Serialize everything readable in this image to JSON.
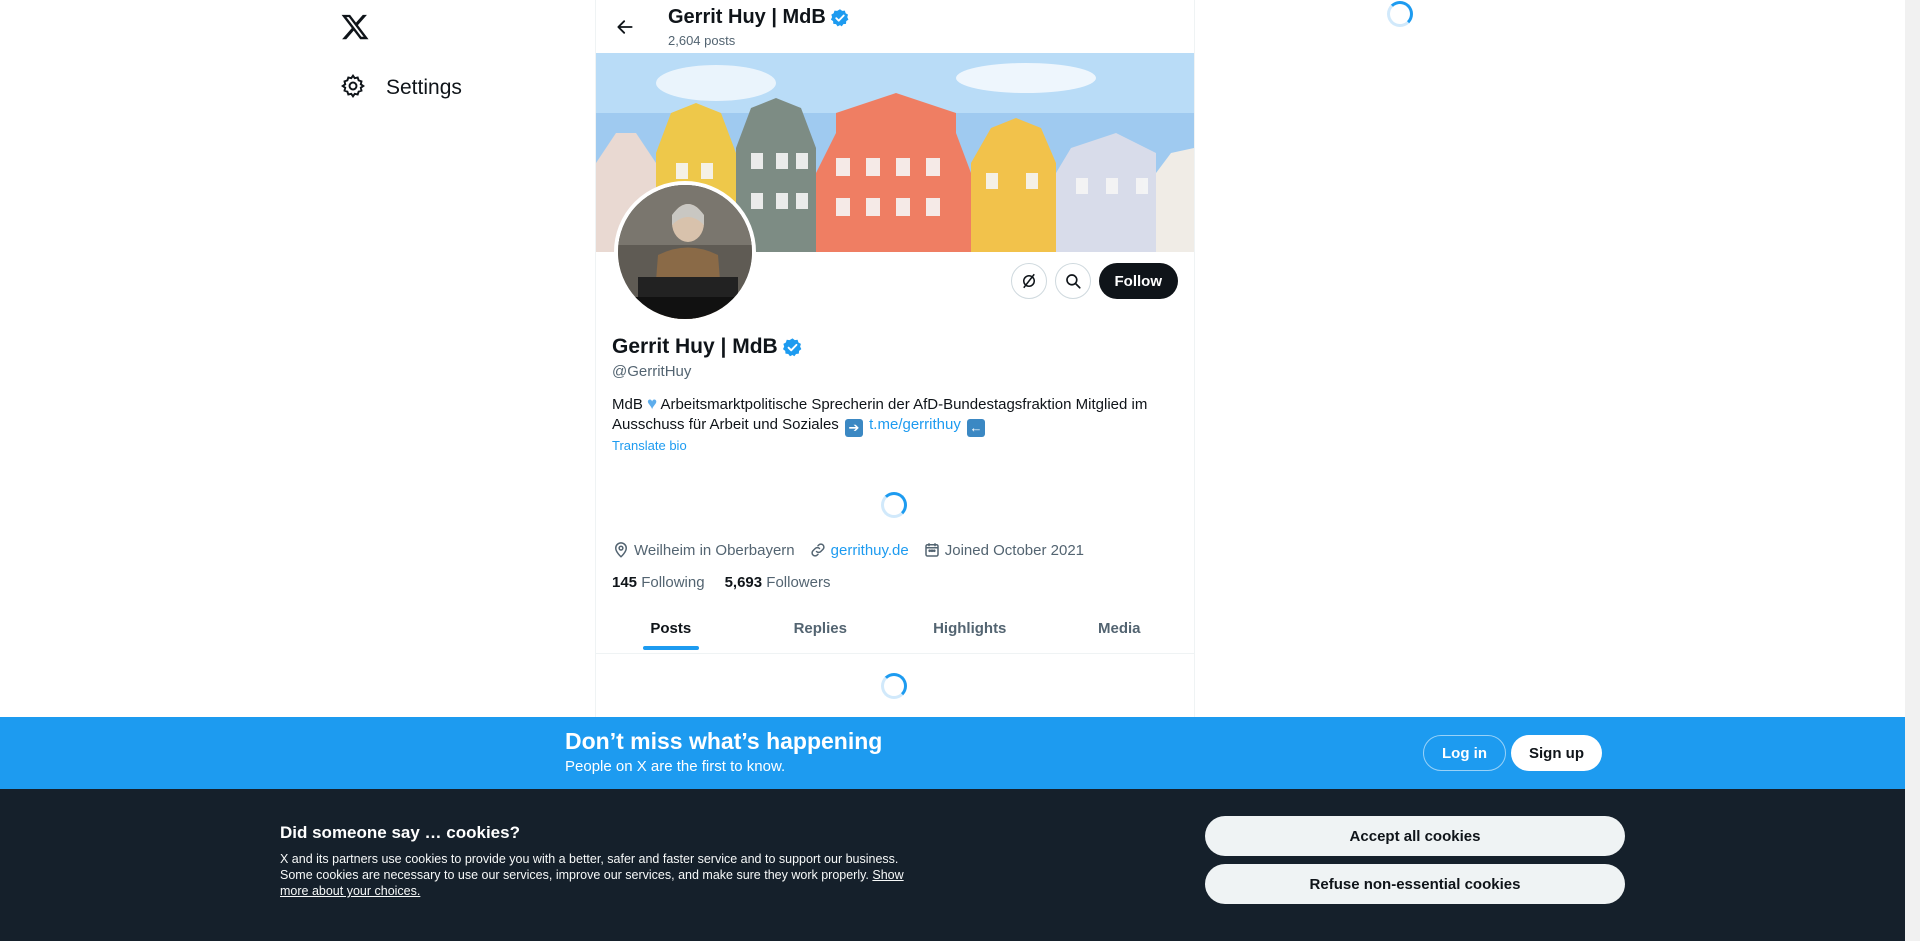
{
  "nav": {
    "settings_label": "Settings"
  },
  "header": {
    "name": "Gerrit Huy | MdB",
    "post_count": "2,604 posts"
  },
  "profile": {
    "name": "Gerrit Huy | MdB",
    "handle": "@GerritHuy",
    "bio_part1": "MdB",
    "bio_part2": "Arbeitsmarktpolitische Sprecherin der AfD-Bundestagsfraktion Mitglied im Ausschuss für Arbeit und Soziales",
    "bio_link": "t.me/gerrithuy",
    "translate_label": "Translate bio",
    "location": "Weilheim in Oberbayern",
    "website": "gerrithuy.de",
    "joined": "Joined October 2021",
    "following_count": "145",
    "following_label": "Following",
    "followers_count": "5,693",
    "followers_label": "Followers",
    "follow_label": "Follow"
  },
  "tabs": [
    {
      "label": "Posts",
      "active": true
    },
    {
      "label": "Replies",
      "active": false
    },
    {
      "label": "Highlights",
      "active": false
    },
    {
      "label": "Media",
      "active": false
    }
  ],
  "login_bar": {
    "title": "Don’t miss what’s happening",
    "subtitle": "People on X are the first to know.",
    "login_label": "Log in",
    "signup_label": "Sign up"
  },
  "cookies": {
    "title": "Did someone say … cookies?",
    "text": "X and its partners use cookies to provide you with a better, safer and faster service and to support our business. Some cookies are necessary to use our services, improve our services, and make sure they work properly.",
    "more_link": "Show more about your choices.",
    "accept_label": "Accept all cookies",
    "refuse_label": "Refuse non-essential cookies"
  },
  "colors": {
    "accent": "#1d9bf0",
    "text": "#0f1419",
    "muted": "#536471",
    "cookie_bg": "#15202b"
  }
}
